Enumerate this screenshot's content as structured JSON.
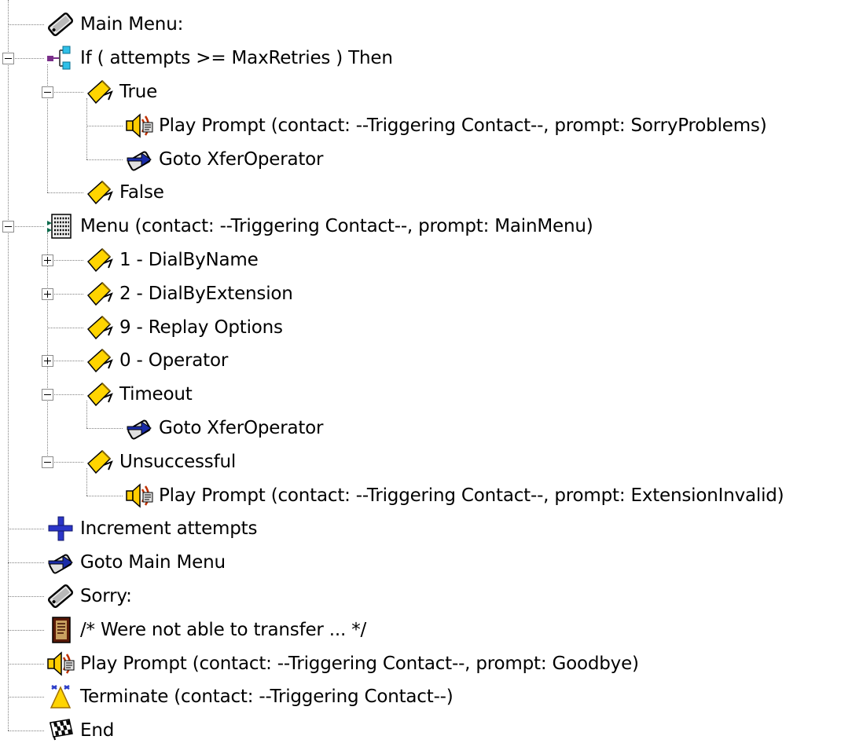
{
  "nodes": [
    {
      "label": "Main Menu:",
      "icon": "label-icon",
      "level": 0,
      "toggle": "none"
    },
    {
      "label": "If ( attempts >=  MaxRetries  ) Then",
      "icon": "if-icon",
      "level": 0,
      "toggle": "minus"
    },
    {
      "label": "True",
      "icon": "branch-icon",
      "level": 1,
      "toggle": "minus"
    },
    {
      "label": "Play Prompt (contact: --Triggering Contact--, prompt: SorryProblems)",
      "icon": "play-prompt-icon",
      "level": 2,
      "toggle": "none"
    },
    {
      "label": "Goto XferOperator",
      "icon": "goto-icon",
      "level": 2,
      "toggle": "none"
    },
    {
      "label": "False",
      "icon": "branch-icon",
      "level": 1,
      "toggle": "none"
    },
    {
      "label": "Menu (contact: --Triggering Contact--, prompt: MainMenu)",
      "icon": "menu-icon",
      "level": 0,
      "toggle": "minus"
    },
    {
      "label": "1 - DialByName",
      "icon": "branch-icon",
      "level": 1,
      "toggle": "plus"
    },
    {
      "label": "2 - DialByExtension",
      "icon": "branch-icon",
      "level": 1,
      "toggle": "plus"
    },
    {
      "label": "9 - Replay Options",
      "icon": "branch-icon",
      "level": 1,
      "toggle": "none"
    },
    {
      "label": "0 - Operator",
      "icon": "branch-icon",
      "level": 1,
      "toggle": "plus"
    },
    {
      "label": "Timeout",
      "icon": "branch-icon",
      "level": 1,
      "toggle": "minus"
    },
    {
      "label": "Goto XferOperator",
      "icon": "goto-icon",
      "level": 2,
      "toggle": "none"
    },
    {
      "label": "Unsuccessful",
      "icon": "branch-icon",
      "level": 1,
      "toggle": "minus"
    },
    {
      "label": "Play Prompt (contact: --Triggering Contact--, prompt: ExtensionInvalid)",
      "icon": "play-prompt-icon",
      "level": 2,
      "toggle": "none"
    },
    {
      "label": "Increment attempts",
      "icon": "increment-icon",
      "level": 0,
      "toggle": "none"
    },
    {
      "label": "Goto Main Menu",
      "icon": "goto-icon",
      "level": 0,
      "toggle": "none"
    },
    {
      "label": "Sorry:",
      "icon": "label-icon",
      "level": 0,
      "toggle": "none"
    },
    {
      "label": "/* Were not able to transfer ... */",
      "icon": "comment-icon",
      "level": 0,
      "toggle": "none"
    },
    {
      "label": "Play Prompt (contact: --Triggering Contact--, prompt: Goodbye)",
      "icon": "play-prompt-icon",
      "level": 0,
      "toggle": "none"
    },
    {
      "label": "Terminate (contact: --Triggering Contact--)",
      "icon": "terminate-icon",
      "level": 0,
      "toggle": "none"
    },
    {
      "label": "End",
      "icon": "end-icon",
      "level": 0,
      "toggle": "none"
    }
  ],
  "colors": {
    "branch_yellow": "#ffd400",
    "tree_line": "#808080",
    "speaker_yellow": "#ffcc00",
    "goto_blue": "#1a2ca8",
    "plus_blue": "#2b35c8"
  }
}
